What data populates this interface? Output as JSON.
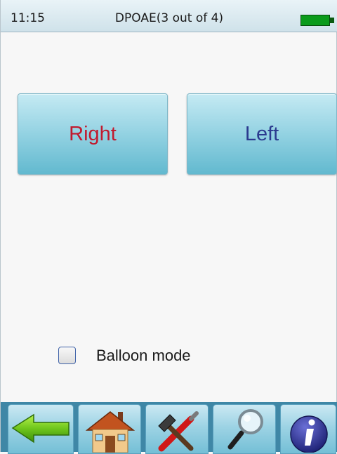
{
  "status_bar": {
    "time": "11:15",
    "title": "DPOAE(3 out of 4)",
    "battery_icon": "battery-full-icon",
    "battery_color": "#0a9b1b"
  },
  "ear_buttons": {
    "right_label": "Right",
    "right_color": "#c11a2e",
    "left_label": "Left",
    "left_color": "#2b3a8f"
  },
  "balloon_mode": {
    "label": "Balloon mode",
    "checked": false
  },
  "toolbar": {
    "items": [
      {
        "icon": "back-arrow-icon"
      },
      {
        "icon": "home-icon"
      },
      {
        "icon": "tools-icon"
      },
      {
        "icon": "search-icon"
      },
      {
        "icon": "info-icon"
      }
    ]
  }
}
